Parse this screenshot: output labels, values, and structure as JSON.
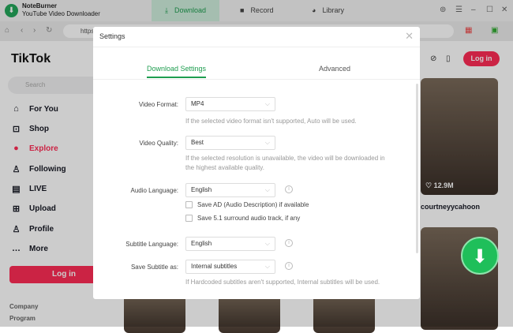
{
  "app": {
    "name": "NoteBurner",
    "subtitle": "YouTube Video Downloader"
  },
  "tabs": [
    {
      "label": "Download",
      "icon": "download-icon"
    },
    {
      "label": "Record",
      "icon": "camera-icon"
    },
    {
      "label": "Library",
      "icon": "clock-icon"
    }
  ],
  "address": {
    "url": "https"
  },
  "tiktok": {
    "logo": "TikTok",
    "search_placeholder": "Search",
    "nav": [
      {
        "label": "For You",
        "icon": "home-icon"
      },
      {
        "label": "Shop",
        "icon": "shop-icon"
      },
      {
        "label": "Explore",
        "icon": "compass-icon"
      },
      {
        "label": "Following",
        "icon": "following-icon"
      },
      {
        "label": "LIVE",
        "icon": "live-icon"
      },
      {
        "label": "Upload",
        "icon": "upload-icon"
      },
      {
        "label": "Profile",
        "icon": "profile-icon"
      },
      {
        "label": "More",
        "icon": "more-icon"
      }
    ],
    "login": "Log in",
    "footer": [
      "Company",
      "Program"
    ],
    "top_login": "Log in",
    "video": {
      "views": "12.9M",
      "user": "courtneyycahoon"
    }
  },
  "accent": "#1e9d4f",
  "tiktok_red": "#fe2c55",
  "settings": {
    "title": "Settings",
    "tabs": [
      "Download Settings",
      "Advanced"
    ],
    "video_format": {
      "label": "Video Format:",
      "value": "MP4",
      "hint": "If the selected video format isn't supported, Auto will be used."
    },
    "video_quality": {
      "label": "Video Quality:",
      "value": "Best",
      "hint": "If the selected resolution is unavailable, the video will be downloaded in the highest available quality."
    },
    "audio_language": {
      "label": "Audio Language:",
      "value": "English"
    },
    "checkboxes": [
      {
        "label": "Save AD (Audio Description) if available",
        "checked": false
      },
      {
        "label": "Save 5.1 surround audio track, if any",
        "checked": false
      }
    ],
    "subtitle_language": {
      "label": "Subtitle Language:",
      "value": "English"
    },
    "save_subtitle": {
      "label": "Save Subtitle as:",
      "value": "Internal subtitles",
      "hint": "If Hardcoded subtitles aren't supported, Internal subtitles will be used."
    }
  }
}
